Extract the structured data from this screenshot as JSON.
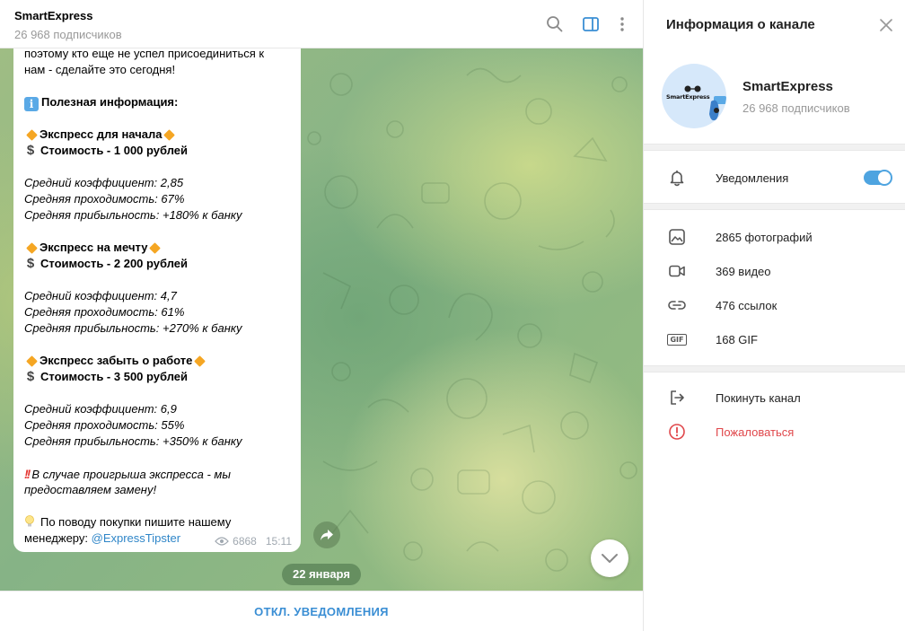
{
  "chat": {
    "title": "SmartExpress",
    "subscribers": "26 968 подписчиков",
    "message": {
      "lines": [
        "поэтому кто еще не успел присоединиться к",
        "нам - сделайте это сегодня!",
        "Полезная информация:",
        "Экспресс для начала",
        "Стоимость - 1 000 рублей",
        "Средний коэффициент: 2,85",
        "Средняя проходимость: 67%",
        "Средняя прибыльность: +180% к банку",
        "Экспресс на мечту",
        "Стоимость - 2 200 рублей",
        "Средний коэффициент: 4,7",
        "Средняя проходимость: 61%",
        "Средняя прибыльность: +270% к банку",
        "Экспресс забыть о работе",
        "Стоимость - 3 500 рублей",
        "Средний коэффициент: 6,9",
        "Средняя проходимость: 55%",
        "Средняя прибыльность: +350% к банку",
        "В случае проигрыша экспресса - мы",
        "предоставляем замену!",
        "По поводу покупки пишите нашему",
        "менеджеру: ",
        "@ExpressTipster"
      ],
      "views": "6868",
      "time": "15:11"
    },
    "date_pill": "22 января",
    "footer_button": "ОТКЛ. УВЕДОМЛЕНИЯ"
  },
  "panel": {
    "title": "Информация о канале",
    "channel_name": "SmartExpress",
    "channel_subscribers": "26 968 подписчиков",
    "avatar_text": "SmartExpress",
    "notifications_label": "Уведомления",
    "notifications_on": true,
    "media": [
      {
        "icon": "photo-icon",
        "label": "2865 фотографий"
      },
      {
        "icon": "video-icon",
        "label": "369 видео"
      },
      {
        "icon": "link-icon",
        "label": "476 ссылок"
      },
      {
        "icon": "gif-icon",
        "label": "168 GIF"
      }
    ],
    "leave_label": "Покинуть канал",
    "report_label": "Пожаловаться",
    "gif_badge": "GIF"
  },
  "colors": {
    "accent": "#4ea4e0",
    "link": "#2f86c8",
    "danger": "#e0474b",
    "diamond": "#f5a623"
  }
}
